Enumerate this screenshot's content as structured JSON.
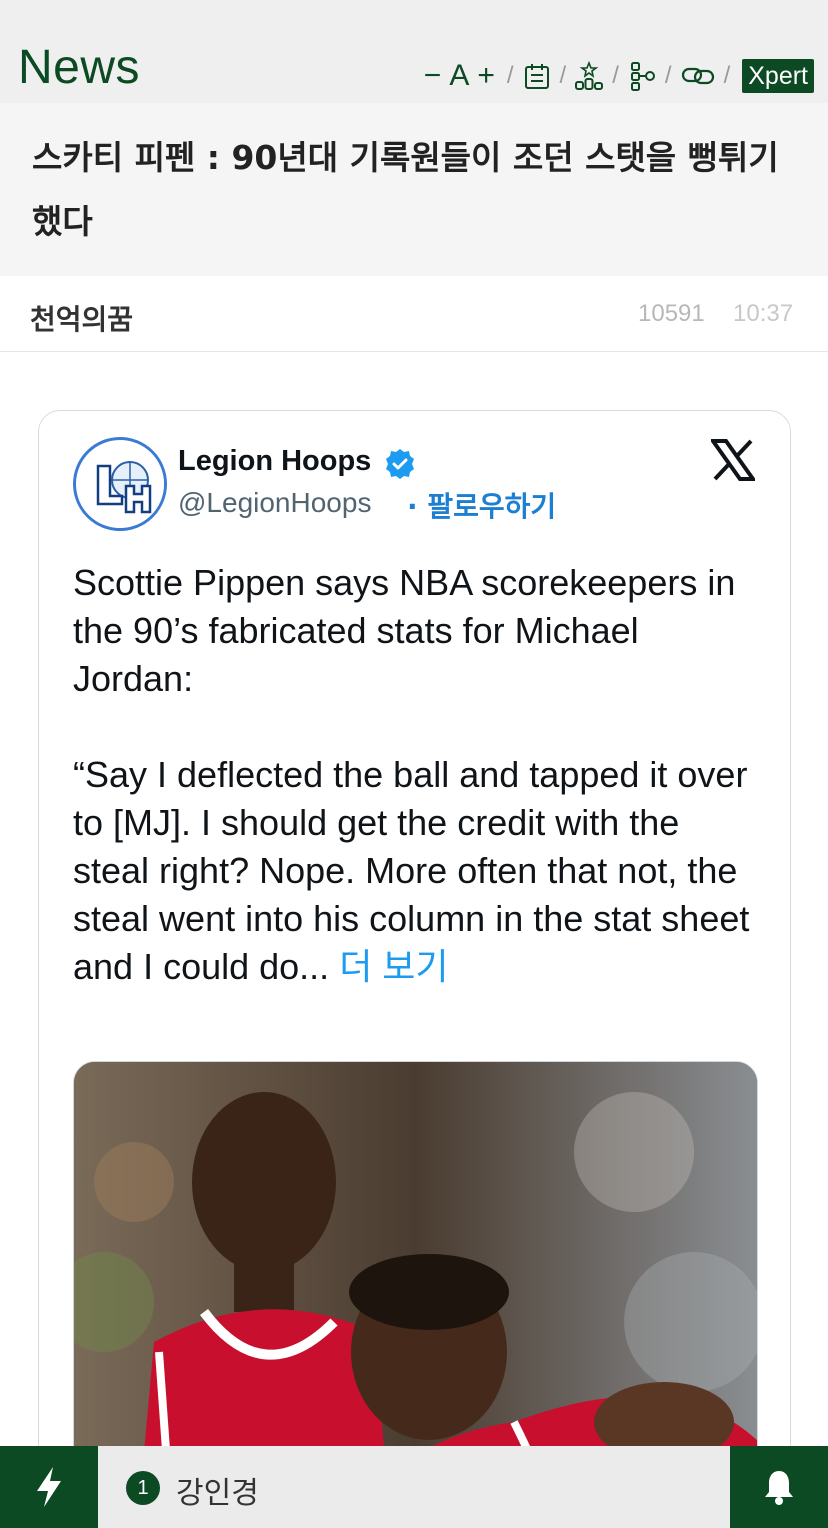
{
  "header": {
    "brand": "News",
    "font_minus": "−",
    "font_a": "A",
    "font_plus": "+",
    "separator": "/",
    "xpert_label": "Xpert",
    "icons": [
      "calendar-icon",
      "ranking-icon",
      "tree-icon",
      "link-icon"
    ],
    "brand_color": "#0b4a22"
  },
  "article": {
    "title": "스카티 피펜 : 90년대 기록원들이 조던 스탯을 뻥튀기 했다",
    "author": "천억의꿈",
    "views": "10591",
    "time": "10:37"
  },
  "tweet": {
    "display_name": "Legion Hoops",
    "handle": "@LegionHoops",
    "follow_label": "· 팔로우하기",
    "text": "Scottie Pippen says NBA scorekeepers in the 90’s fabricated stats for Michael Jordan:\n\n“Say I deflected the ball and tapped it over to [MJ]. I should get the credit with the steal right? Nope. More often that not, the steal went into his column in the stat sheet and I could do...",
    "more_label": " 더 보기",
    "avatar_text": "LH"
  },
  "bottom": {
    "rank": "1",
    "ticker_text": "강인경"
  }
}
